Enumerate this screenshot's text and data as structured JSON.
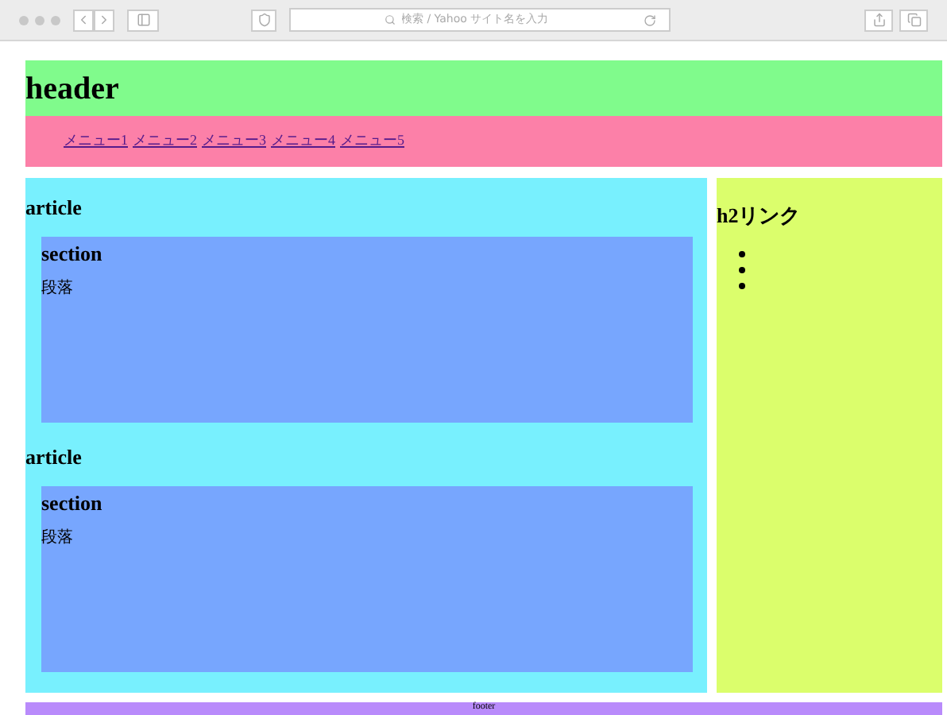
{
  "browser": {
    "address_placeholder": "検索 / Yahoo サイト名を入力"
  },
  "header": {
    "title": "header"
  },
  "nav": {
    "links": [
      "メニュー1",
      "メニュー2",
      "メニュー3",
      "メニュー4",
      "メニュー5"
    ]
  },
  "articles": [
    {
      "title": "article",
      "section": {
        "title": "section",
        "paragraph": "段落"
      }
    },
    {
      "title": "article",
      "section": {
        "title": "section",
        "paragraph": "段落"
      }
    }
  ],
  "aside": {
    "title": "h2リンク",
    "list_items": [
      {
        "kind": "empty"
      },
      {
        "kind": "empty"
      },
      {
        "kind": "empty"
      }
    ]
  },
  "footer": {
    "text": "footer"
  }
}
